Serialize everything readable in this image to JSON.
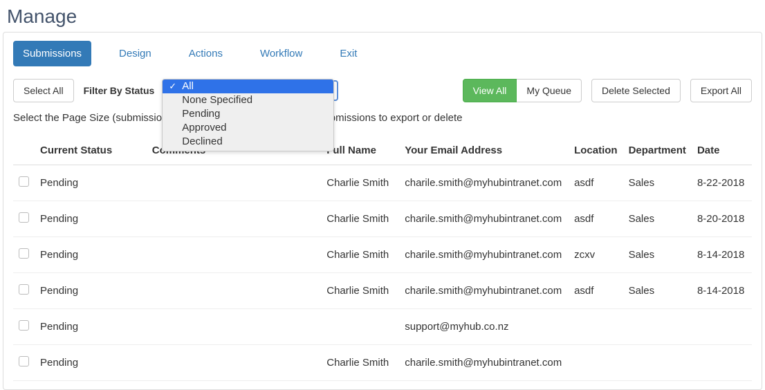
{
  "page_title": "Manage",
  "tabs": [
    {
      "label": "Submissions",
      "active": true
    },
    {
      "label": "Design",
      "active": false
    },
    {
      "label": "Actions",
      "active": false
    },
    {
      "label": "Workflow",
      "active": false
    },
    {
      "label": "Exit",
      "active": false
    }
  ],
  "toolbar": {
    "select_all": "Select All",
    "filter_label": "Filter By Status",
    "filter_options": [
      "All",
      "None Specified",
      "Pending",
      "Approved",
      "Declined"
    ],
    "filter_selected": "All",
    "view_all": "View All",
    "my_queue": "My Queue",
    "delete_selected": "Delete Selected",
    "export_all": "Export All"
  },
  "hint": "Select the Page Size (submissions per page) and/or the individual submissions to export or delete",
  "columns": {
    "status": "Current Status",
    "comments": "Comments",
    "name": "Full Name",
    "email": "Your Email Address",
    "location": "Location",
    "department": "Department",
    "date": "Date"
  },
  "rows": [
    {
      "status": "Pending",
      "comments": "",
      "name": "Charlie Smith",
      "email": "charile.smith@myhubintranet.com",
      "location": "asdf",
      "department": "Sales",
      "date": "8-22-2018"
    },
    {
      "status": "Pending",
      "comments": "",
      "name": "Charlie Smith",
      "email": "charile.smith@myhubintranet.com",
      "location": "asdf",
      "department": "Sales",
      "date": "8-20-2018"
    },
    {
      "status": "Pending",
      "comments": "",
      "name": "Charlie Smith",
      "email": "charile.smith@myhubintranet.com",
      "location": "zcxv",
      "department": "Sales",
      "date": "8-14-2018"
    },
    {
      "status": "Pending",
      "comments": "",
      "name": "Charlie Smith",
      "email": "charile.smith@myhubintranet.com",
      "location": "asdf",
      "department": "Sales",
      "date": "8-14-2018"
    },
    {
      "status": "Pending",
      "comments": "",
      "name": "",
      "email": "support@myhub.co.nz",
      "location": "",
      "department": "",
      "date": ""
    },
    {
      "status": "Pending",
      "comments": "",
      "name": "Charlie Smith",
      "email": "charile.smith@myhubintranet.com",
      "location": "",
      "department": "",
      "date": ""
    }
  ]
}
